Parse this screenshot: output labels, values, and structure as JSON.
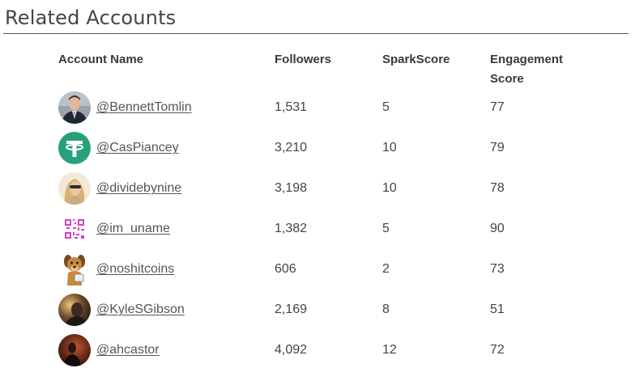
{
  "section": {
    "title": "Related Accounts"
  },
  "columns": {
    "account_name": "Account Name",
    "followers": "Followers",
    "sparkscore": "SparkScore",
    "engagement_line1": "Engagement",
    "engagement_line2": "Score"
  },
  "rows": [
    {
      "handle": "@BennettTomlin",
      "followers": "1,531",
      "sparkscore": "5",
      "engagement": "77",
      "avatar": "man-in-suit-photo"
    },
    {
      "handle": "@CasPiancey",
      "followers": "3,210",
      "sparkscore": "10",
      "engagement": "79",
      "avatar": "tether-logo"
    },
    {
      "handle": "@dividebynine",
      "followers": "3,198",
      "sparkscore": "10",
      "engagement": "78",
      "avatar": "blonde-woman-photo"
    },
    {
      "handle": "@im_uname",
      "followers": "1,382",
      "sparkscore": "5",
      "engagement": "90",
      "avatar": "pink-qr-code"
    },
    {
      "handle": "@noshitcoins",
      "followers": "606",
      "sparkscore": "2",
      "engagement": "73",
      "avatar": "cartoon-dog"
    },
    {
      "handle": "@KyleSGibson",
      "followers": "2,169",
      "sparkscore": "8",
      "engagement": "51",
      "avatar": "dark-portrait-photo"
    },
    {
      "handle": "@ahcastor",
      "followers": "4,092",
      "sparkscore": "12",
      "engagement": "72",
      "avatar": "dark-red-photo"
    }
  ]
}
